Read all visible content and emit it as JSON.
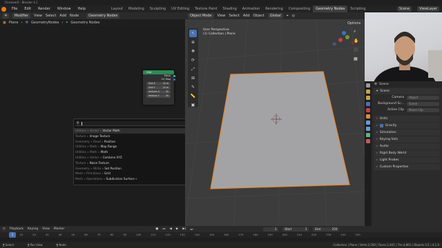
{
  "window": {
    "title": "[Unsaved] - Blender 4.1"
  },
  "menubar": {
    "menus": [
      "File",
      "Edit",
      "Render",
      "Window",
      "Help"
    ],
    "workspaces": [
      "Layout",
      "Modeling",
      "Sculpting",
      "UV Editing",
      "Texture Paint",
      "Shading",
      "Animation",
      "Rendering",
      "Compositing",
      "Geometry Nodes",
      "Scripting"
    ],
    "active_workspace": "Geometry Nodes",
    "scene": "Scene",
    "view_layer": "ViewLayer"
  },
  "node_editor": {
    "header": {
      "mode": "Modifier",
      "menus": [
        "View",
        "Select",
        "Add",
        "Node"
      ],
      "tree": "Geometry Nodes"
    },
    "breadcrumb": [
      "Plane",
      "GeometryNodes",
      "Geometry Nodes"
    ],
    "node": {
      "title": "Grid",
      "outputs": [
        "Mesh",
        "UV Map"
      ],
      "fields": [
        {
          "label": "Size X",
          "value": "10 m"
        },
        {
          "label": "Size Y",
          "value": "10 m"
        },
        {
          "label": "Vertices X",
          "value": "50"
        },
        {
          "label": "Vertices Y",
          "value": "50"
        }
      ]
    },
    "search": {
      "query": "",
      "results": [
        {
          "path": "Utilities » Vector » ",
          "name": "Vector Math"
        },
        {
          "path": "Texture » ",
          "name": "Image Texture"
        },
        {
          "path": "Geometry » Read » ",
          "name": "Position"
        },
        {
          "path": "Utilities » Math » ",
          "name": "Map Range"
        },
        {
          "path": "Utilities » Math » ",
          "name": "Math"
        },
        {
          "path": "Utilities » Vector » ",
          "name": "Combine XYZ"
        },
        {
          "path": "Texture » ",
          "name": "Noise Texture"
        },
        {
          "path": "Geometry » Write » ",
          "name": "Set Position"
        },
        {
          "path": "Mesh » Primitives » ",
          "name": "Grid"
        },
        {
          "path": "Mesh » Operations » ",
          "name": "Subdivision Surface"
        }
      ]
    }
  },
  "viewport": {
    "header": {
      "mode": "Object Mode",
      "menus": [
        "View",
        "Select",
        "Add",
        "Object"
      ],
      "orientation": "Global"
    },
    "info": {
      "view": "User Perspective",
      "collection": "(1) Collection | Plane"
    },
    "options_label": "Options",
    "gizmo_axes": [
      "X",
      "Y",
      "Z"
    ]
  },
  "properties": {
    "scene_label": "Scene",
    "section": "Scene",
    "rows": [
      {
        "label": "Camera",
        "value": "Object"
      },
      {
        "label": "Background Sc...",
        "value": "Scene"
      },
      {
        "label": "Active Clip",
        "value": "Movie Clip"
      }
    ],
    "panels": [
      "Units",
      "Gravity",
      "Simulation",
      "Keying Sets",
      "Audio",
      "Rigid Body World",
      "Light Probes",
      "Custom Properties"
    ]
  },
  "timeline": {
    "menus": [
      "Playback",
      "Keying",
      "View",
      "Marker"
    ],
    "current_frame": "1",
    "start_label": "Start",
    "start": "1",
    "end_label": "End",
    "end": "250",
    "ruler": [
      "1",
      "10",
      "20",
      "30",
      "40",
      "50",
      "60",
      "70",
      "80",
      "90",
      "100",
      "110",
      "120",
      "130",
      "140",
      "150",
      "160",
      "170",
      "180",
      "190",
      "200",
      "210",
      "220",
      "230",
      "240",
      "250"
    ]
  },
  "statusbar": {
    "items": [
      "Select",
      "Pan View",
      "Node"
    ],
    "stats": "Collection | Plane | Verts:2,500 | Faces:2,401 | Tris:4,802 | Objects:1/1 | 4.1.0"
  },
  "colors": {
    "accent": "#4772b3",
    "node_header": "#2b8a56",
    "selection_outline": "#e8872a",
    "blender_logo": "#e87d0d"
  }
}
